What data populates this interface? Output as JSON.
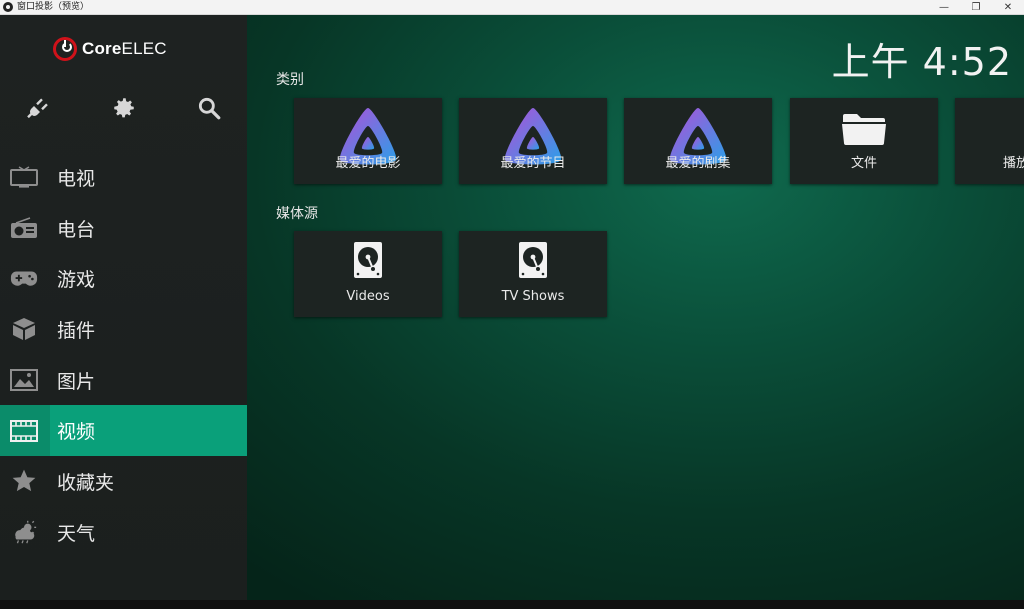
{
  "window": {
    "title": "窗口投影（预览）",
    "minimize": "—",
    "maximize": "❐",
    "close": "✕"
  },
  "brand": {
    "name_bold": "Core",
    "name_rest": "ELEC",
    "accent": "#d0121a"
  },
  "clock": "上午 4:52",
  "toolbar": [
    {
      "name": "power-plug-icon"
    },
    {
      "name": "gear-icon"
    },
    {
      "name": "search-icon"
    }
  ],
  "menu": [
    {
      "label": "电视",
      "icon": "tv-icon"
    },
    {
      "label": "电台",
      "icon": "radio-icon"
    },
    {
      "label": "游戏",
      "icon": "gamepad-icon"
    },
    {
      "label": "插件",
      "icon": "addon-box-icon"
    },
    {
      "label": "图片",
      "icon": "picture-icon"
    },
    {
      "label": "视频",
      "icon": "film-icon",
      "active": true
    },
    {
      "label": "收藏夹",
      "icon": "star-icon"
    },
    {
      "label": "天气",
      "icon": "weather-icon"
    }
  ],
  "categories": {
    "title": "类别",
    "tiles": [
      {
        "label": "最爱的电影",
        "icon": "jellyfin-icon"
      },
      {
        "label": "最爱的节目",
        "icon": "jellyfin-icon"
      },
      {
        "label": "最爱的剧集",
        "icon": "jellyfin-icon"
      },
      {
        "label": "文件",
        "icon": "folder-icon"
      },
      {
        "label": "播放",
        "icon": "playlist-icon"
      }
    ]
  },
  "sources": {
    "title": "媒体源",
    "tiles": [
      {
        "label": "Videos",
        "icon": "hard-drive-icon"
      },
      {
        "label": "TV Shows",
        "icon": "hard-drive-icon"
      }
    ]
  },
  "colors": {
    "active_item": "#0aa07a",
    "background": "#0a4d38",
    "sidebar": "#1e2221"
  }
}
